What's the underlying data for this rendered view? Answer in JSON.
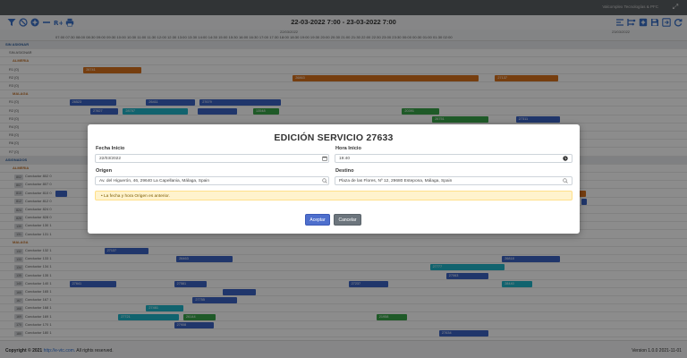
{
  "topbar": {
    "company": "Valcomplex Tecnologías & PFC"
  },
  "toolbar": {
    "date_range": "22-03-2022 7:00 - 23-03-2022 7:00"
  },
  "timeline": {
    "day_a": "22/03/2022",
    "day_b": "23/03/2022",
    "hours": "07:00 07:30 08:00 08:30 09:00 09:30 10:00 10:30 11:00 11:30 12:00 12:30 13:00 13:30 14:00 14:30 15:00 15:30 16:00 16:30 17:00 17:30 18:00 18:30 19:00 19:30 20:00 20:30 21:00 21:30 22:00 22:30 23:00 23:30 00:00 00:30 01:00 01:30 02:00"
  },
  "rows": [
    {
      "kind": "group",
      "label": "SIN ASIGNAR"
    },
    {
      "kind": "plain",
      "label": "SIN ASIGNAR"
    },
    {
      "kind": "sub",
      "label": "ALMERIA"
    },
    {
      "kind": "plain",
      "label": "R1 [0]"
    },
    {
      "kind": "plain",
      "label": "R2 [0]"
    },
    {
      "kind": "plain",
      "label": "R3 [0]"
    },
    {
      "kind": "sub",
      "label": "MALAGA"
    },
    {
      "kind": "plain",
      "label": "R1 [0]"
    },
    {
      "kind": "plain",
      "label": "R2 [0]"
    },
    {
      "kind": "plain",
      "label": "R3 [0]"
    },
    {
      "kind": "plain",
      "label": "R4 [0]"
    },
    {
      "kind": "plain",
      "label": "R5 [0]"
    },
    {
      "kind": "plain",
      "label": "R6 [0]"
    },
    {
      "kind": "plain",
      "label": "R7 [0]"
    },
    {
      "kind": "group",
      "label": "ASIGNADOS"
    },
    {
      "kind": "sub",
      "label": "ALMERIA"
    },
    {
      "kind": "driver",
      "tag": "802",
      "label": "Conductor 802 0"
    },
    {
      "kind": "driver",
      "tag": "807",
      "label": "Conductor 807 0"
    },
    {
      "kind": "driver",
      "tag": "810",
      "label": "Conductor 810 0"
    },
    {
      "kind": "driver",
      "tag": "812",
      "label": "Conductor 812 0"
    },
    {
      "kind": "driver",
      "tag": "824",
      "label": "Conductor 824 0"
    },
    {
      "kind": "driver",
      "tag": "828",
      "label": "Conductor 828 0"
    },
    {
      "kind": "driver",
      "tag": "130",
      "label": "Conductor 130 1"
    },
    {
      "kind": "driver",
      "tag": "131",
      "label": "Conductor 131 1"
    },
    {
      "kind": "sub",
      "label": "MALAGA"
    },
    {
      "kind": "driver",
      "tag": "132",
      "label": "Conductor 132 1"
    },
    {
      "kind": "driver",
      "tag": "133",
      "label": "Conductor 133 1"
    },
    {
      "kind": "driver",
      "tag": "134",
      "label": "Conductor 134 1"
    },
    {
      "kind": "driver",
      "tag": "135",
      "label": "Conductor 135 1"
    },
    {
      "kind": "driver",
      "tag": "140",
      "label": "Conductor 140 1"
    },
    {
      "kind": "driver",
      "tag": "165",
      "label": "Conductor 165 1"
    },
    {
      "kind": "driver",
      "tag": "167",
      "label": "Conductor 167 1"
    },
    {
      "kind": "driver",
      "tag": "168",
      "label": "Conductor 168 1"
    },
    {
      "kind": "driver",
      "tag": "169",
      "label": "Conductor 169 1"
    },
    {
      "kind": "driver",
      "tag": "170",
      "label": "Conductor 170 1"
    },
    {
      "kind": "driver",
      "tag": "180",
      "label": "Conductor 180 1"
    }
  ],
  "services": [
    {
      "row": 3,
      "start": "08:00",
      "end": "10:05",
      "color": "#d8711c",
      "label": "26741"
    },
    {
      "row": 4,
      "start": "15:30",
      "end": "22:10",
      "color": "#d8711c",
      "label": "26863"
    },
    {
      "row": 4,
      "start": "22:45",
      "end": "01:00",
      "color": "#d8711c",
      "label": "27137"
    },
    {
      "row": 7,
      "start": "07:30",
      "end": "09:10",
      "color": "#3b63c4",
      "label": "26523"
    },
    {
      "row": 7,
      "start": "10:15",
      "end": "12:00",
      "color": "#3b63c4",
      "label": "26411"
    },
    {
      "row": 7,
      "start": "12:10",
      "end": "15:05",
      "color": "#3b63c4",
      "label": "27679"
    },
    {
      "row": 8,
      "start": "08:15",
      "end": "09:15",
      "color": "#3b63c4",
      "label": "27827"
    },
    {
      "row": 8,
      "start": "09:25",
      "end": "11:45",
      "color": "#20b5c8",
      "label": "28757"
    },
    {
      "row": 8,
      "start": "12:05",
      "end": "13:30",
      "color": "#3b63c4",
      "label": ""
    },
    {
      "row": 8,
      "start": "14:05",
      "end": "15:00",
      "color": "#3aa44a",
      "label": "13548"
    },
    {
      "row": 8,
      "start": "19:25",
      "end": "20:45",
      "color": "#3aa44a",
      "label": "20391"
    },
    {
      "row": 9,
      "start": "20:30",
      "end": "22:30",
      "color": "#3aa44a",
      "label": "26751"
    },
    {
      "row": 9,
      "start": "23:30",
      "end": "01:05",
      "color": "#3b63c4",
      "label": "27311"
    },
    {
      "row": 18,
      "start": "07:00",
      "end": "07:25",
      "color": "#3b63c4",
      "label": ""
    },
    {
      "row": 18,
      "start": "01:35",
      "end": "02:00",
      "color": "#d8711c",
      "label": ""
    },
    {
      "row": 19,
      "start": "01:50",
      "end": "02:00",
      "color": "#3b63c4",
      "label": ""
    },
    {
      "row": 25,
      "start": "08:45",
      "end": "10:20",
      "color": "#3b63c4",
      "label": "27137"
    },
    {
      "row": 26,
      "start": "11:20",
      "end": "13:20",
      "color": "#3b63c4",
      "label": "26463"
    },
    {
      "row": 26,
      "start": "23:00",
      "end": "01:05",
      "color": "#3b63c4",
      "label": "26818"
    },
    {
      "row": 27,
      "start": "20:25",
      "end": "23:05",
      "color": "#20b5c8",
      "label": "27777"
    },
    {
      "row": 28,
      "start": "21:00",
      "end": "22:30",
      "color": "#3b63c4",
      "label": "27063"
    },
    {
      "row": 29,
      "start": "07:30",
      "end": "09:10",
      "color": "#3b63c4",
      "label": "27641"
    },
    {
      "row": 29,
      "start": "11:15",
      "end": "12:25",
      "color": "#3b63c4",
      "label": "27581"
    },
    {
      "row": 29,
      "start": "17:30",
      "end": "18:55",
      "color": "#3b63c4",
      "label": "27237"
    },
    {
      "row": 29,
      "start": "23:00",
      "end": "00:05",
      "color": "#20b5c8",
      "label": "28440"
    },
    {
      "row": 30,
      "start": "13:00",
      "end": "14:10",
      "color": "#3b63c4",
      "label": ""
    },
    {
      "row": 31,
      "start": "11:55",
      "end": "13:30",
      "color": "#3b63c4",
      "label": "27755"
    },
    {
      "row": 32,
      "start": "10:15",
      "end": "11:35",
      "color": "#20b5c8",
      "label": "27461"
    },
    {
      "row": 33,
      "start": "09:15",
      "end": "11:25",
      "color": "#20b5c8",
      "label": "27721"
    },
    {
      "row": 33,
      "start": "11:35",
      "end": "12:45",
      "color": "#3aa44a",
      "label": "26144"
    },
    {
      "row": 33,
      "start": "18:30",
      "end": "19:35",
      "color": "#3aa44a",
      "label": "21958"
    },
    {
      "row": 34,
      "start": "11:15",
      "end": "12:40",
      "color": "#3b63c4",
      "label": "27908"
    },
    {
      "row": 35,
      "start": "20:45",
      "end": "22:30",
      "color": "#3b63c4",
      "label": "27634"
    }
  ],
  "modal": {
    "title": "EDICIÓN SERVICIO 27633",
    "fecha_inicio_label": "Fecha Inicio",
    "fecha_inicio_value": "22/03/2022",
    "hora_inicio_label": "Hora Inicio",
    "hora_inicio_value": "19:40",
    "origen_label": "Origen",
    "origen_value": "Av. del Higuerón, 46, 29640 La Capellania, Málaga, Spain",
    "destino_label": "Destino",
    "destino_value": "Plaza de las Flores, Nº 12, 29680 Estepona, Málaga, Spain",
    "alert_text": "La fecha y hora Origen es anterior.",
    "accept_label": "Aceptar",
    "cancel_label": "Cancelar"
  },
  "footer": {
    "copy_prefix": "Copyright © 2021 ",
    "copy_link": "http://e-vtc.com.",
    "copy_suffix": " All rights reserved.",
    "version": "Version 1.0.0 2021-11-01"
  }
}
